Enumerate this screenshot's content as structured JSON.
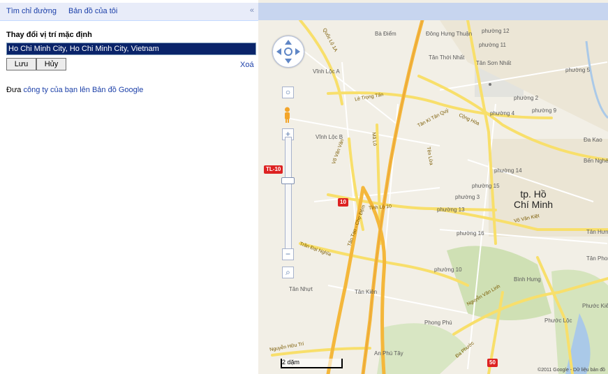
{
  "tabs": {
    "directions": "Tìm chỉ đường",
    "my_maps": "Bản đồ của tôi",
    "collapse": "«"
  },
  "location": {
    "title": "Thay đổi vị trí mặc định",
    "value": "Ho Chi Minh City, Ho Chi Minh City, Vietnam",
    "save_label": "Lưu",
    "cancel_label": "Hủy",
    "delete_label": "Xoá"
  },
  "promo": {
    "prefix": "Đưa ",
    "link": "công ty của bạn lên Bản đồ Google"
  },
  "map": {
    "city_line1": "tp. Hồ",
    "city_line2": "Chí Minh",
    "places": [
      "Bà Điểm",
      "Đông Hưng Thuận",
      "Tân Thới Nhất",
      "Tân Sơn Nhất",
      "Vĩnh Lộc A",
      "Vĩnh Lộc B",
      "phường 12",
      "phường 11",
      "phường 5",
      "phường 2",
      "phường 4",
      "phường 9",
      "phường 14",
      "phường 15",
      "phường 3",
      "phường 13",
      "phường 10",
      "phường 16",
      "Tân Nhựt",
      "Tân Kiên",
      "Phong Phú",
      "An Phú Tây",
      "Bình Hưng",
      "Phước Lộc",
      "Tân Hưng",
      "Tân Phong",
      "Đa Kao",
      "Bến Nghé",
      "Phước Kiển"
    ],
    "roads": [
      "Quốc Lộ 1A",
      "Lê Trọng Tấn",
      "Tân Kì Tân Quý",
      "Cộng Hòa",
      "Võ Văn Vân",
      "Mã Lò",
      "Tên Lửa",
      "Tân Tạo - Chợ Đệm",
      "Tỉnh Lộ 10",
      "Trần Đại Nghĩa",
      "Võ Văn Kiệt",
      "Nguyễn Văn Linh",
      "Nguyễn Hữu Trí",
      "Đa Phước"
    ],
    "shields": [
      "TL-10",
      "10",
      "50"
    ],
    "scale": "2 dặm",
    "copyright": "©2011 Google - Dữ liệu bản đồ"
  },
  "colors": {
    "link": "#1b3fa8",
    "tabbar": "#e8ecf9",
    "map_bg": "#f2efe6",
    "highway": "#f4b73b",
    "road": "#f8df6b"
  }
}
